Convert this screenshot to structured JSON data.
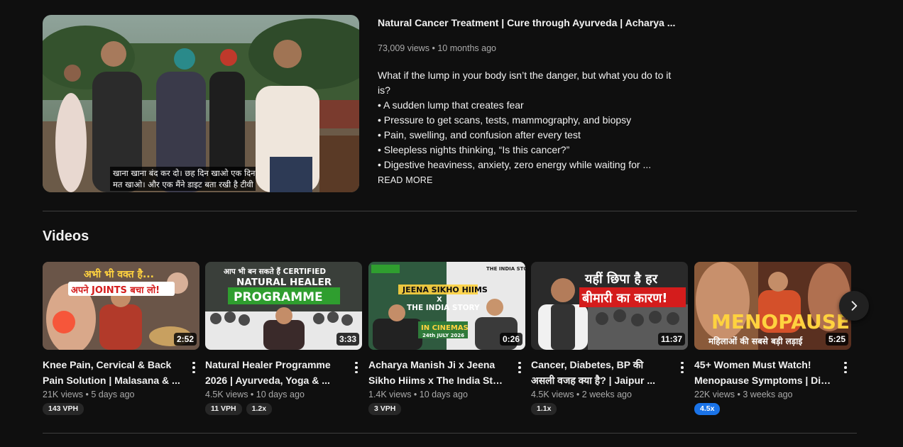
{
  "featured": {
    "caption_line1": "खाना खाना बंद कर दो। छह दिन खाओ एक दिन",
    "caption_line2": "मत खाओ। और एक मैंने डाइट बता रखी है टीवी",
    "title": "Natural Cancer Treatment | Cure through Ayurveda | Acharya ...",
    "views": "73,009 views",
    "age": "10 months ago",
    "description": [
      "What if the lump in your body isn’t the danger, but what you do to it is?",
      "• A sudden lump that creates fear",
      " • Pressure to get scans, tests, mammography, and biopsy",
      " • Pain, swelling, and confusion after every test",
      " • Sleepless nights thinking, “Is this cancer?”",
      " • Digestive heaviness, anxiety, zero energy while waiting for ..."
    ],
    "read_more": "READ MORE"
  },
  "section": {
    "title": "Videos"
  },
  "videos": [
    {
      "thumb_text_1": "अभी भी वक्त है...",
      "thumb_text_2": "अपने JOINTS बचा लो!",
      "duration": "2:52",
      "title_line1": "Knee Pain, Cervical & Back",
      "title_line2": "Pain Solution | Malasana & ...",
      "views": "21K views",
      "age": "5 days ago",
      "badges": [
        "143 VPH"
      ]
    },
    {
      "thumb_text_1": "आप भी बन सकते हैं CERTIFIED",
      "thumb_text_2": "NATURAL HEALER",
      "thumb_text_3": "PROGRAMME",
      "duration": "3:33",
      "title_line1": "Natural Healer Programme",
      "title_line2": "2026 | Ayurveda, Yoga & ...",
      "views": "4.5K views",
      "age": "10 days ago",
      "badges": [
        "11 VPH",
        "1.2x"
      ]
    },
    {
      "thumb_text_1": "JEENA SIKHO HIIMS",
      "thumb_text_2": "X",
      "thumb_text_3": "THE INDIA STORY",
      "thumb_text_4": "IN CINEMAS",
      "thumb_text_5": "24th JULY 2026",
      "thumb_text_6": "THE INDIA STORY",
      "duration": "0:26",
      "title_line1": "Acharya Manish Ji x Jeena",
      "title_line2": "Sikho Hiims x The India Story",
      "views": "1.4K views",
      "age": "10 days ago",
      "badges": [
        "3 VPH"
      ]
    },
    {
      "thumb_text_1": "यहीं छिपा है हर",
      "thumb_text_2": "बीमारी का कारण!",
      "duration": "11:37",
      "title_line1": "Cancer, Diabetes, BP की",
      "title_line2": "असली वजह क्या है? | Jaipur ...",
      "views": "4.5K views",
      "age": "2 weeks ago",
      "badges": [
        "1.1x"
      ]
    },
    {
      "thumb_text_1": "MENOPAUSE",
      "thumb_text_2": "महिलाओं की सबसे बड़ी लड़ाई",
      "duration": "5:25",
      "title_line1": "45+ Women Must Watch!",
      "title_line2": "Menopause Symptoms | Die...",
      "views": "22K views",
      "age": "3 weeks ago",
      "badges": [
        "4.5x"
      ]
    }
  ],
  "colors": {
    "background": "#0f0f0f",
    "text_primary": "#f1f1f1",
    "text_secondary": "#aaaaaa",
    "badge_bg": "#272727",
    "badge_highlight": "#1a73e8",
    "divider": "#3f3f3f"
  },
  "icons": {
    "kebab": "more-vert-icon",
    "next": "chevron-right-icon"
  }
}
